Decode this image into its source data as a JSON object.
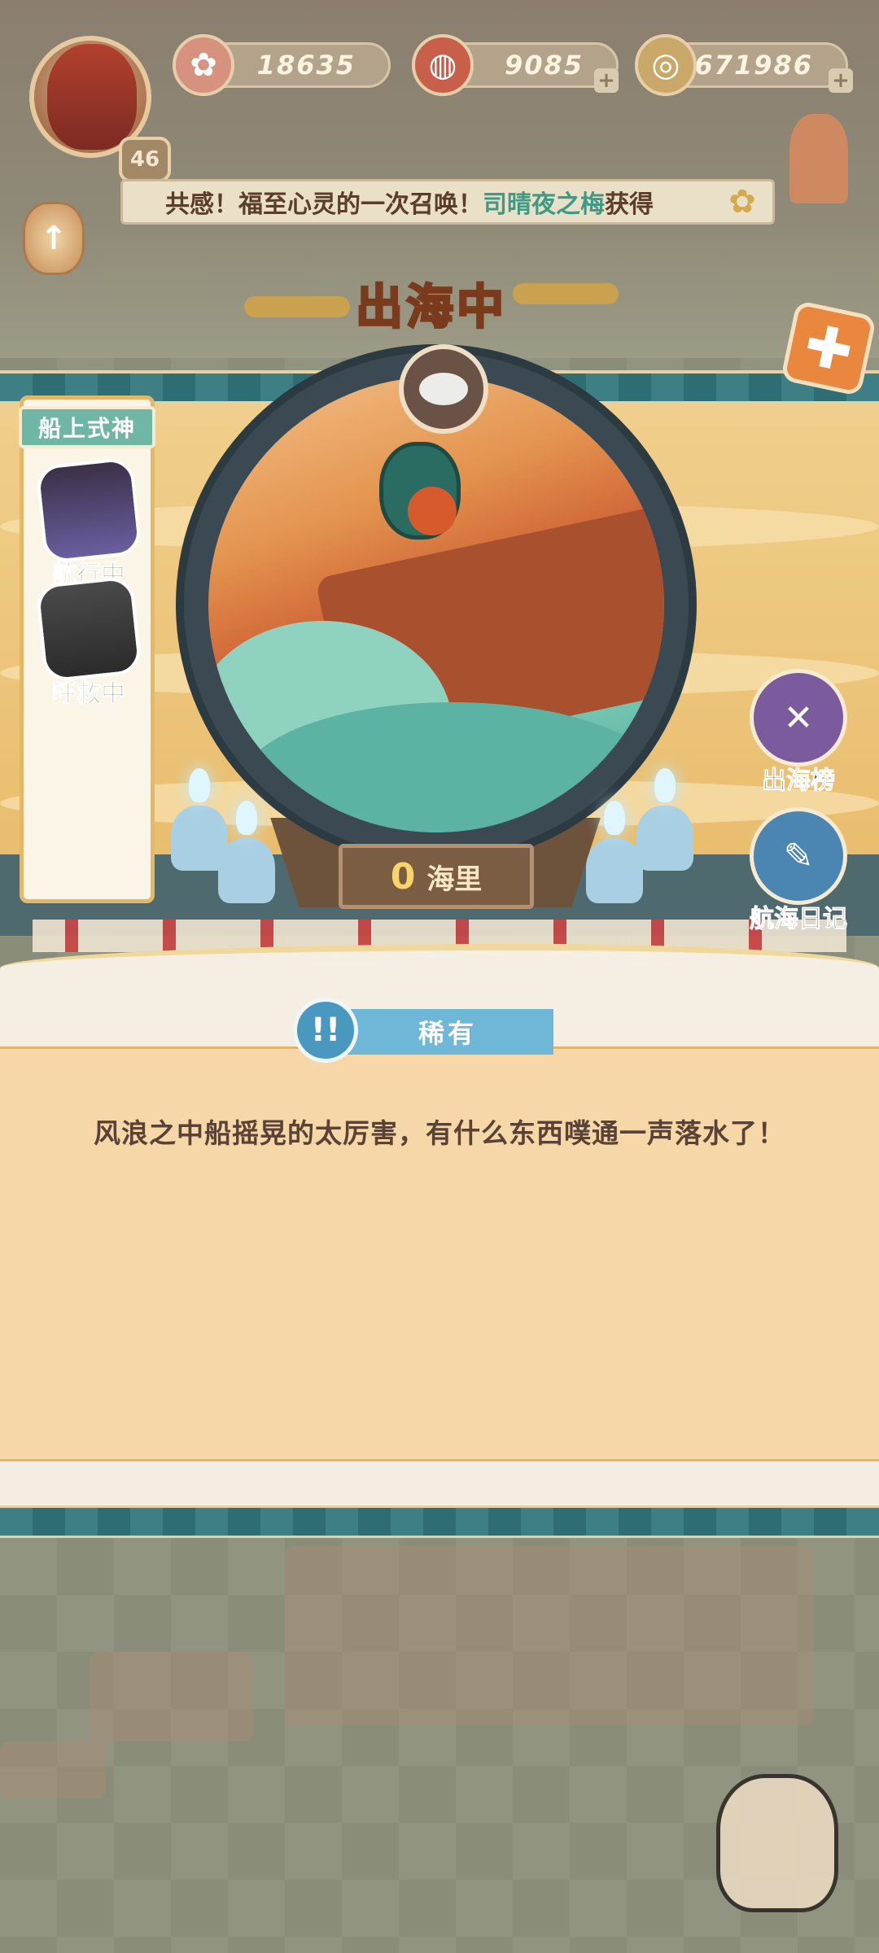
{
  "resources": {
    "player_level": "46",
    "sakura_amount": "18635",
    "magatama_amount": "9085",
    "coin_amount": "671986"
  },
  "marquee": {
    "text_before": "共感！福至心灵的一次召唤！",
    "highlight": "司晴夜之梅",
    "text_after": "获得"
  },
  "title": "出海中",
  "crew": {
    "title": "船上式神",
    "members": [
      {
        "status": "航行中"
      },
      {
        "status": "呼救中"
      }
    ]
  },
  "distance": {
    "value": "0",
    "unit": "海里"
  },
  "side_buttons": {
    "leaderboard": "出海榜",
    "voyage_log": "航海日记"
  },
  "event": {
    "rarity": "稀有",
    "description": "风浪之中船摇晃的太厉害，有什么东西噗通一声落水了！"
  },
  "colors": {
    "teal": "#3e7f86",
    "rarity_blue": "#6fb7d6",
    "card": "#f6d7a8",
    "accent_orange": "#e8873d"
  }
}
